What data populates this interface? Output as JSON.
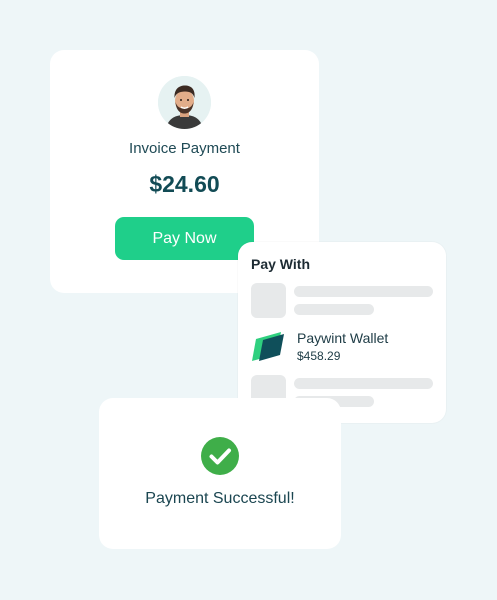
{
  "invoice": {
    "title": "Invoice Payment",
    "amount": "$24.60",
    "pay_button_label": "Pay Now"
  },
  "pay_with": {
    "title": "Pay With",
    "options": [
      {
        "type": "placeholder"
      },
      {
        "type": "wallet",
        "name": "Paywint Wallet",
        "balance": "$458.29",
        "icon": "paywint-logo-icon"
      },
      {
        "type": "placeholder"
      }
    ]
  },
  "success": {
    "message": "Payment Successful!",
    "icon": "check-circle-icon"
  },
  "colors": {
    "background": "#eef6f8",
    "accent_green": "#1fcf8a",
    "check_green": "#3fae49",
    "brand_dark": "#124b55",
    "skeleton": "#e7e9ea"
  }
}
